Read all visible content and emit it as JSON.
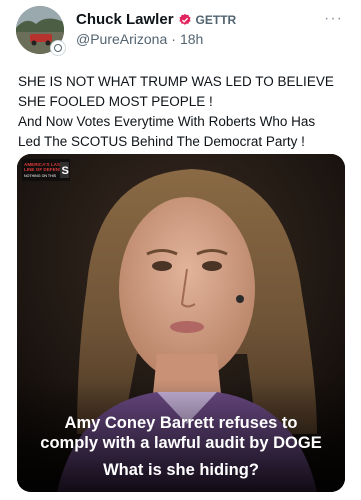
{
  "post": {
    "author": {
      "display_name": "Chuck Lawler",
      "platform": "GETTR",
      "handle": "@PureArizona",
      "separator": "·",
      "time": "18h",
      "verified_icon": "verified-badge-icon",
      "verified_color": "#e0245e"
    },
    "more_label": "···",
    "text_lines": [
      "SHE IS NOT WHAT TRUMP WAS LED TO BELIEVE",
      "SHE FOOLED MOST PEOPLE !",
      "And Now Votes Everytime With Roberts Who Has",
      "Led The SCOTUS Behind The Democrat Party !"
    ],
    "media": {
      "caption_line1": "Amy Coney Barrett refuses to",
      "caption_line2": "comply with a lawful audit by DOGE",
      "caption_line3": "What is she hiding?",
      "logo_text": "AMERICA'S LAST LINE OF DEFENSE"
    }
  }
}
